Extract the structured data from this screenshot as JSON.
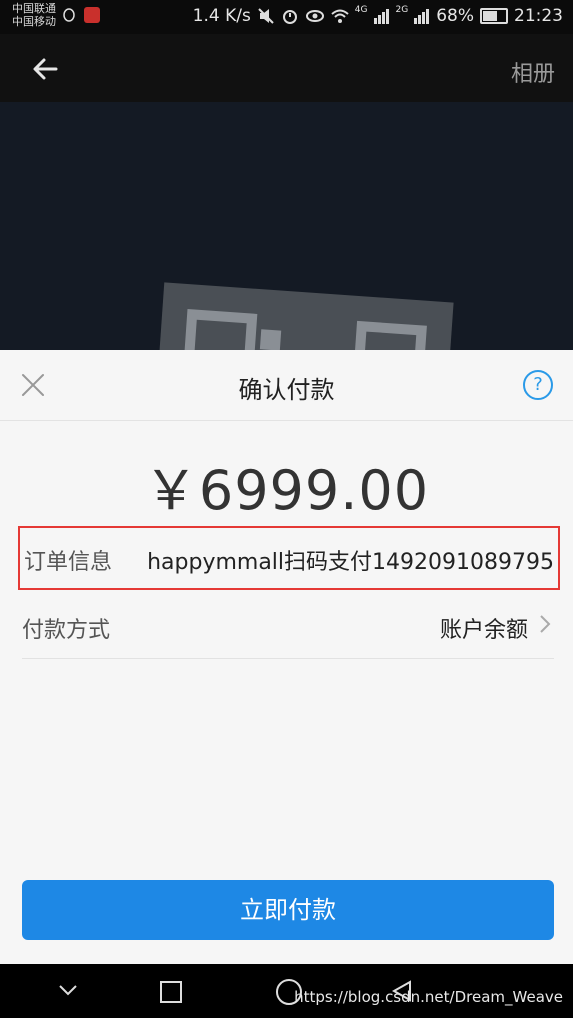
{
  "status_bar": {
    "carrier_1": "中国联通",
    "carrier_2": "中国移动",
    "speed": "1.4 K/s",
    "network_1": "4G",
    "network_2": "2G",
    "battery": "68%",
    "time": "21:23",
    "battery_fraction": 0.68
  },
  "header": {
    "back_icon": "arrow-left-icon",
    "album_label": "相册"
  },
  "dialog": {
    "close_icon": "close-icon",
    "title": "确认付款",
    "help_icon": "help-icon",
    "help_glyph": "?",
    "amount": "￥6999.00",
    "rows": [
      {
        "label": "订单信息",
        "value": "happymmall扫码支付1492091089795"
      },
      {
        "label": "付款方式",
        "value": "账户余额"
      }
    ],
    "pay_button": "立即付款"
  },
  "navbar": {
    "watermark": "https://blog.csdn.net/Dream_Weave"
  },
  "colors": {
    "accent": "#1e88e5",
    "highlight_border": "#e53935",
    "sheet_bg": "#f6f6f6"
  }
}
